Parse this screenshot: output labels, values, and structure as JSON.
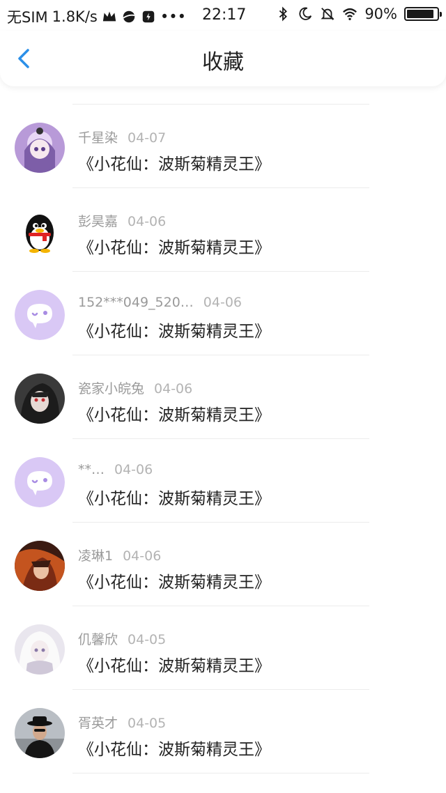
{
  "status_bar": {
    "carrier": "无SIM",
    "speed": "1.8K/s",
    "time": "22:17",
    "battery": "90%",
    "battery_level": 0.9
  },
  "header": {
    "title": "收藏"
  },
  "items": [
    {
      "user": "千星染",
      "date": "04-07",
      "title": "《小花仙：波斯菊精灵王》",
      "avatar": "anime-girl-purple"
    },
    {
      "user": "彭昊嘉",
      "date": "04-06",
      "title": "《小花仙：波斯菊精灵王》",
      "avatar": "qq-penguin"
    },
    {
      "user": "152***049_520…",
      "date": "04-06",
      "title": "《小花仙：波斯菊精灵王》",
      "avatar": "default-chat-bubble"
    },
    {
      "user": "瓷家小皖兔",
      "date": "04-06",
      "title": "《小花仙：波斯菊精灵王》",
      "avatar": "anime-dark"
    },
    {
      "user": "**…",
      "date": "04-06",
      "title": "《小花仙：波斯菊精灵王》",
      "avatar": "default-chat-bubble"
    },
    {
      "user": "凌琳1",
      "date": "04-06",
      "title": "《小花仙：波斯菊精灵王》",
      "avatar": "anime-orange"
    },
    {
      "user": "仉馨欣",
      "date": "04-05",
      "title": "《小花仙：波斯菊精灵王》",
      "avatar": "anime-white"
    },
    {
      "user": "胥英才",
      "date": "04-05",
      "title": "《小花仙：波斯菊精灵王》",
      "avatar": "man-with-hat"
    }
  ],
  "colors": {
    "accent": "#2b8fe8",
    "default_avatar_bg": "#d9c8f5",
    "default_avatar_fg": "#a88ce3"
  }
}
